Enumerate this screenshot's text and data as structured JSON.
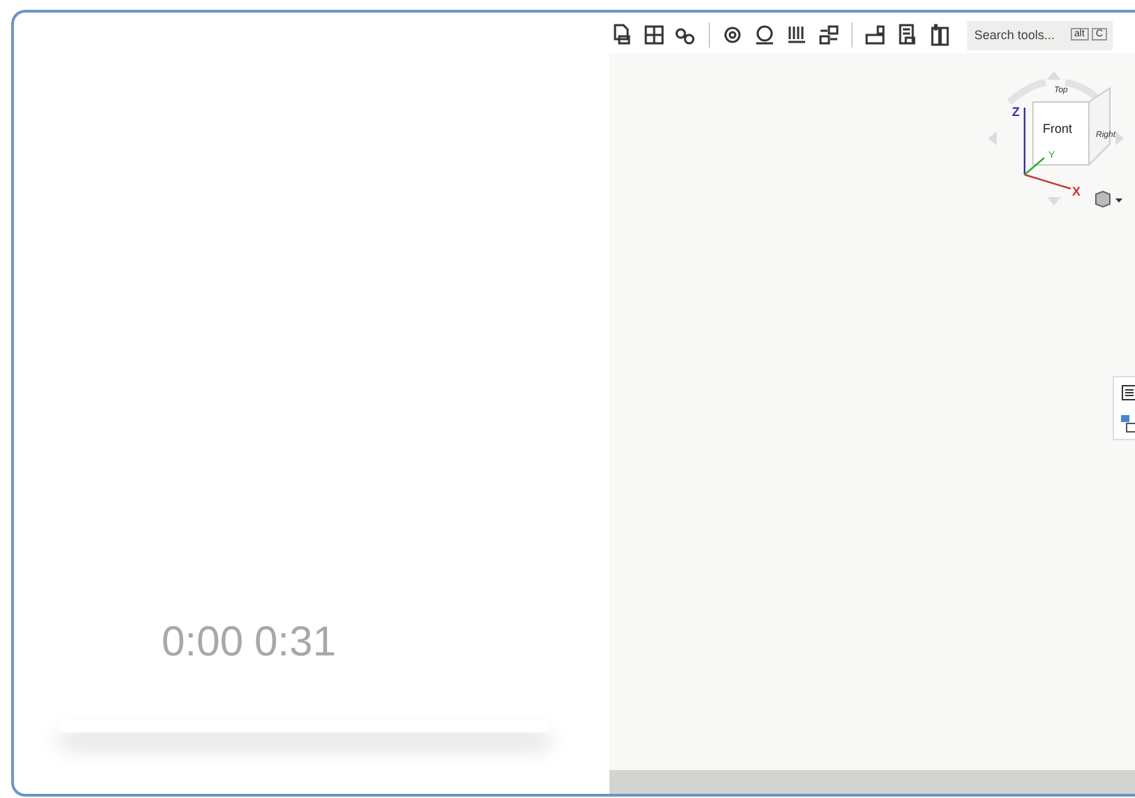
{
  "player": {
    "current_time": "0:00",
    "duration": "0:31",
    "level": 0
  },
  "toolbar": {
    "search": {
      "placeholder": "Search tools...",
      "shortcut_keys": [
        "alt",
        "C"
      ]
    }
  },
  "view_cube": {
    "faces": [
      "Top",
      "Front",
      "Right"
    ],
    "axes": [
      "Z",
      "Y",
      "X"
    ]
  }
}
